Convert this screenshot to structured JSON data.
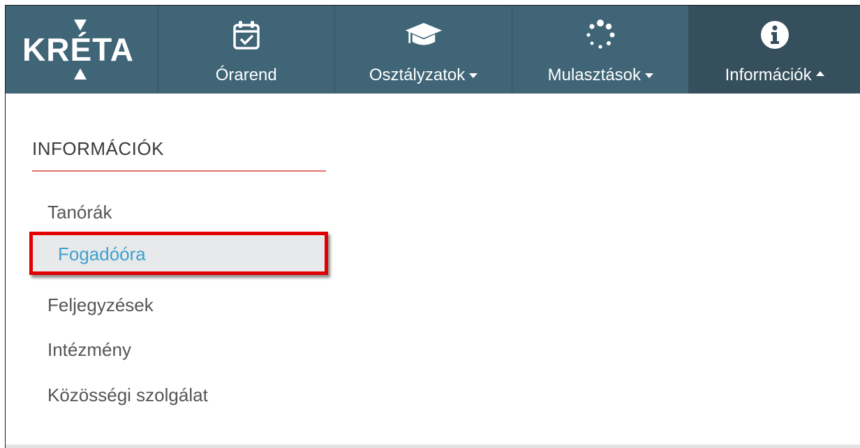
{
  "navbar": {
    "logo": "KRÉTA",
    "items": [
      {
        "label": "Órarend",
        "icon": "calendar-check-icon",
        "caret": "none"
      },
      {
        "label": "Osztályzatok",
        "icon": "graduation-cap-icon",
        "caret": "down"
      },
      {
        "label": "Mulasztások",
        "icon": "spinner-dots-icon",
        "caret": "down"
      },
      {
        "label": "Információk",
        "icon": "info-circle-icon",
        "caret": "up",
        "active": true
      }
    ]
  },
  "sidebar": {
    "heading": "INFORMÁCIÓK",
    "items": [
      {
        "label": "Tanórák"
      },
      {
        "label": "Fogadóóra",
        "selected": true
      },
      {
        "label": "Feljegyzések"
      },
      {
        "label": "Intézmény"
      },
      {
        "label": "Közösségi szolgálat"
      }
    ]
  },
  "colors": {
    "navbar_bg": "#3f6577",
    "navbar_active_bg": "#354f5c",
    "heading_rule": "#e3716a",
    "highlight_border": "#e20000",
    "selected_text": "#3fa1cf"
  }
}
